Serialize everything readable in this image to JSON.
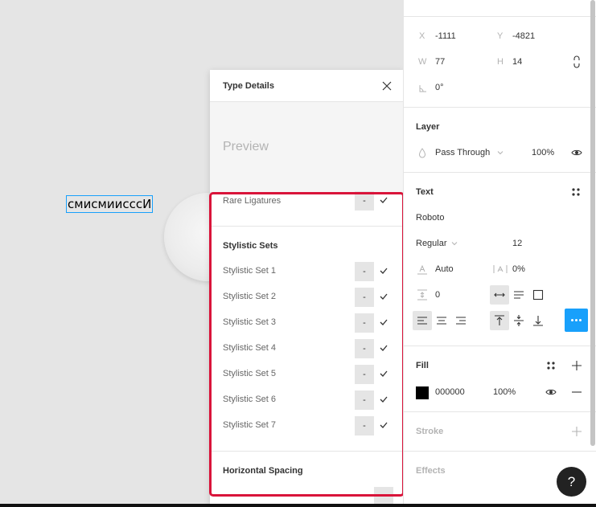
{
  "canvas": {
    "selected_text": "смисмиисссИ"
  },
  "popup": {
    "title": "Type Details",
    "preview": "Preview",
    "rare_ligatures": {
      "label": "Rare Ligatures",
      "toggle": "-"
    },
    "stylistic_sets_title": "Stylistic Sets",
    "stylistic_sets": [
      {
        "label": "Stylistic Set 1",
        "toggle": "-"
      },
      {
        "label": "Stylistic Set 2",
        "toggle": "-"
      },
      {
        "label": "Stylistic Set 3",
        "toggle": "-"
      },
      {
        "label": "Stylistic Set 4",
        "toggle": "-"
      },
      {
        "label": "Stylistic Set 5",
        "toggle": "-"
      },
      {
        "label": "Stylistic Set 6",
        "toggle": "-"
      },
      {
        "label": "Stylistic Set 7",
        "toggle": "-"
      }
    ],
    "horizontal_spacing_title": "Horizontal Spacing"
  },
  "panel": {
    "x_label": "X",
    "x_value": "-1111",
    "y_label": "Y",
    "y_value": "-4821",
    "w_label": "W",
    "w_value": "77",
    "h_label": "H",
    "h_value": "14",
    "rotation_value": "0°",
    "layer": {
      "title": "Layer",
      "blend_mode": "Pass Through",
      "opacity": "100%"
    },
    "text": {
      "title": "Text",
      "font_family": "Roboto",
      "font_weight": "Regular",
      "font_size": "12",
      "line_height": "Auto",
      "letter_spacing": "0%",
      "paragraph_spacing": "0"
    },
    "fill": {
      "title": "Fill",
      "hex": "000000",
      "opacity": "100%",
      "color": "#000000"
    },
    "stroke": {
      "title": "Stroke"
    },
    "effects": {
      "title": "Effects"
    }
  },
  "help_label": "?",
  "colors": {
    "accent": "#18a0fb",
    "highlight": "#d9143a"
  }
}
